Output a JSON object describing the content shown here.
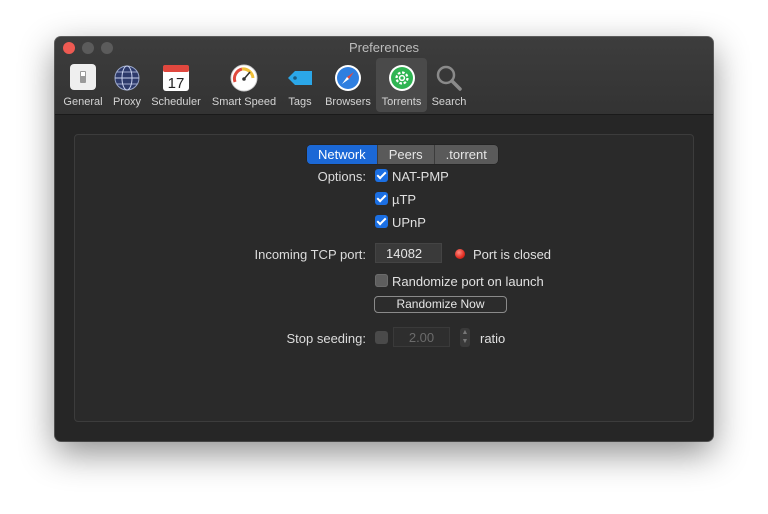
{
  "window": {
    "title": "Preferences"
  },
  "toolbar": {
    "items": [
      {
        "label": "General",
        "icon": "general-switch-icon"
      },
      {
        "label": "Proxy",
        "icon": "globe-icon"
      },
      {
        "label": "Scheduler",
        "icon": "calendar-icon",
        "calendar_day": "17"
      },
      {
        "label": "Smart Speed",
        "icon": "speedometer-icon"
      },
      {
        "label": "Tags",
        "icon": "tag-icon"
      },
      {
        "label": "Browsers",
        "icon": "compass-icon"
      },
      {
        "label": "Torrents",
        "icon": "gear-torrent-icon",
        "selected": true
      },
      {
        "label": "Search",
        "icon": "magnifier-icon"
      }
    ]
  },
  "tabs": [
    {
      "label": "Network",
      "active": true
    },
    {
      "label": "Peers",
      "active": false
    },
    {
      "label": ".torrent",
      "active": false
    }
  ],
  "options": {
    "label": "Options:",
    "items": [
      {
        "label": "NAT-PMP",
        "checked": true
      },
      {
        "label": "µTP",
        "checked": true
      },
      {
        "label": "UPnP",
        "checked": true
      }
    ]
  },
  "port": {
    "label": "Incoming TCP port:",
    "value": "14082",
    "status": "Port is closed",
    "status_color": "#e02b20",
    "randomize_checkbox_label": "Randomize port on launch",
    "randomize_checked": false,
    "randomize_button": "Randomize Now"
  },
  "seeding": {
    "label": "Stop seeding:",
    "checked": false,
    "ratio_value": "2.00",
    "unit": "ratio"
  },
  "colors": {
    "accent": "#1b68d6",
    "close": "#ee5a52",
    "window_bg": "#262626"
  }
}
